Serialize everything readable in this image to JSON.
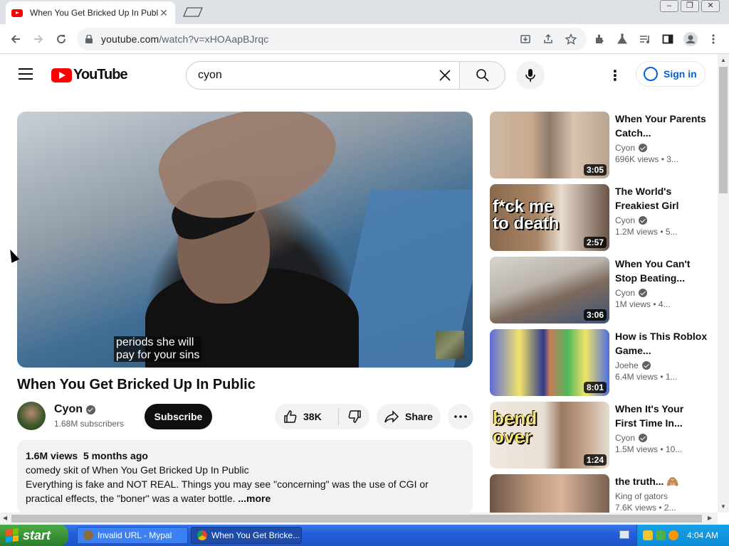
{
  "browser": {
    "tab_title": "When You Get Bricked Up In Public",
    "url_host": "youtube.com",
    "url_path": "/watch?v=xHOAapBJrqc"
  },
  "youtube": {
    "logo_text": "YouTube",
    "search_value": "cyon",
    "sign_in_label": "Sign in"
  },
  "player": {
    "caption": "periods she will\npay for your sins"
  },
  "video": {
    "title": "When You Get Bricked Up In Public",
    "channel": "Cyon",
    "subscribers": "1.68M subscribers",
    "subscribe_label": "Subscribe",
    "likes": "38K",
    "share_label": "Share",
    "views": "1.6M views",
    "age": "5 months ago",
    "desc_line1": "comedy skit of When You Get Bricked Up In Public",
    "desc_line2": "Everything is fake and NOT REAL. Things you may see \"concerning\" was the use of CGI  or practical effects, the \"boner\" was a water bottle.",
    "more_label": "...more"
  },
  "related": [
    {
      "title": "When Your Parents Catch...",
      "channel": "Cyon",
      "views": "696K views",
      "age": "3...",
      "duration": "3:05",
      "overlay": ""
    },
    {
      "title": "The World's Freakiest Girl",
      "channel": "Cyon",
      "views": "1.2M views",
      "age": "5...",
      "duration": "2:57",
      "overlay": "f*ck me to death"
    },
    {
      "title": "When You Can't Stop Beating...",
      "channel": "Cyon",
      "views": "1M views",
      "age": "4...",
      "duration": "3:06",
      "overlay": ""
    },
    {
      "title": "How is This Roblox Game...",
      "channel": "Joehe",
      "views": "6.4M views",
      "age": "1...",
      "duration": "8:01",
      "overlay": ""
    },
    {
      "title": "When It's Your First Time In...",
      "channel": "Cyon",
      "views": "1.5M views",
      "age": "10...",
      "duration": "1:24",
      "overlay": "bend over"
    },
    {
      "title": "the truth... 🙈",
      "channel": "King of gators",
      "views": "7.6K views",
      "age": "2...",
      "duration": "",
      "overlay": ""
    }
  ],
  "taskbar": {
    "start_label": "start",
    "task1": "Invalid URL - Mypal",
    "task2": "When You Get Bricke...",
    "clock": "4:04 AM"
  }
}
